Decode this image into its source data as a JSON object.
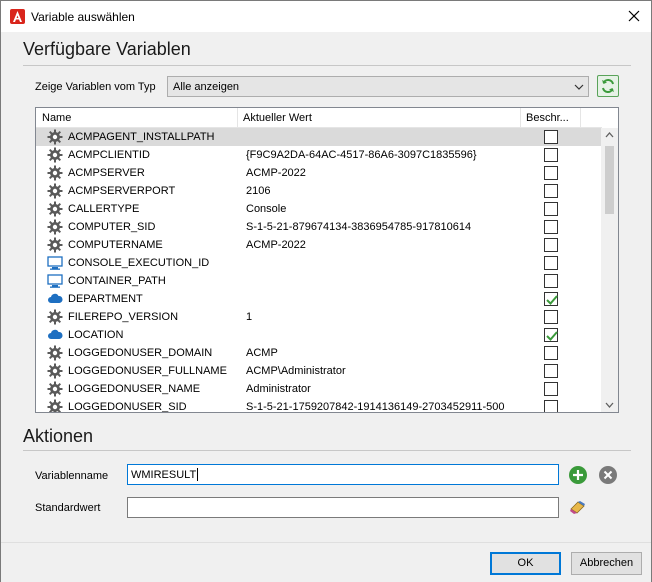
{
  "window": {
    "title": "Variable auswählen"
  },
  "sections": {
    "available": "Verfügbare Variablen",
    "actions": "Aktionen"
  },
  "filter": {
    "label": "Zeige Variablen vom Typ",
    "selected": "Alle anzeigen"
  },
  "table": {
    "columns": [
      "Name",
      "Aktueller Wert",
      "Beschr..."
    ],
    "rows": [
      {
        "icon": "gear-icon",
        "name": "ACMPAGENT_INSTALLPATH",
        "value": "",
        "checked": false
      },
      {
        "icon": "gear-icon",
        "name": "ACMPCLIENTID",
        "value": "{F9C9A2DA-64AC-4517-86A6-3097C1835596}",
        "checked": false
      },
      {
        "icon": "gear-icon",
        "name": "ACMPSERVER",
        "value": "ACMP-2022",
        "checked": false
      },
      {
        "icon": "gear-icon",
        "name": "ACMPSERVERPORT",
        "value": "2106",
        "checked": false
      },
      {
        "icon": "gear-icon",
        "name": "CALLERTYPE",
        "value": "Console",
        "checked": false
      },
      {
        "icon": "gear-icon",
        "name": "COMPUTER_SID",
        "value": "S-1-5-21-879674134-3836954785-917810614",
        "checked": false
      },
      {
        "icon": "gear-icon",
        "name": "COMPUTERNAME",
        "value": "ACMP-2022",
        "checked": false
      },
      {
        "icon": "monitor-icon",
        "name": "CONSOLE_EXECUTION_ID",
        "value": "",
        "checked": false
      },
      {
        "icon": "monitor-icon",
        "name": "CONTAINER_PATH",
        "value": "",
        "checked": false
      },
      {
        "icon": "cloud-icon",
        "name": "DEPARTMENT",
        "value": "",
        "checked": true
      },
      {
        "icon": "gear-icon",
        "name": "FILEREPO_VERSION",
        "value": "1",
        "checked": false
      },
      {
        "icon": "cloud-icon",
        "name": "LOCATION",
        "value": "",
        "checked": true
      },
      {
        "icon": "gear-icon",
        "name": "LOGGEDONUSER_DOMAIN",
        "value": "ACMP",
        "checked": false
      },
      {
        "icon": "gear-icon",
        "name": "LOGGEDONUSER_FULLNAME",
        "value": "ACMP\\Administrator",
        "checked": false
      },
      {
        "icon": "gear-icon",
        "name": "LOGGEDONUSER_NAME",
        "value": "Administrator",
        "checked": false
      },
      {
        "icon": "gear-icon",
        "name": "LOGGEDONUSER_SID",
        "value": "S-1-5-21-1759207842-1914136149-2703452911-500",
        "checked": false
      }
    ],
    "selected_index": 0
  },
  "form": {
    "name_label": "Variablenname",
    "name_value": "WMIRESULT",
    "default_label": "Standardwert",
    "default_value": ""
  },
  "buttons": {
    "ok": "OK",
    "cancel": "Abbrechen"
  },
  "colors": {
    "accent": "#0078d7",
    "brand_red": "#d9251c",
    "green": "#3a9a3a",
    "selection": "#dadada"
  }
}
